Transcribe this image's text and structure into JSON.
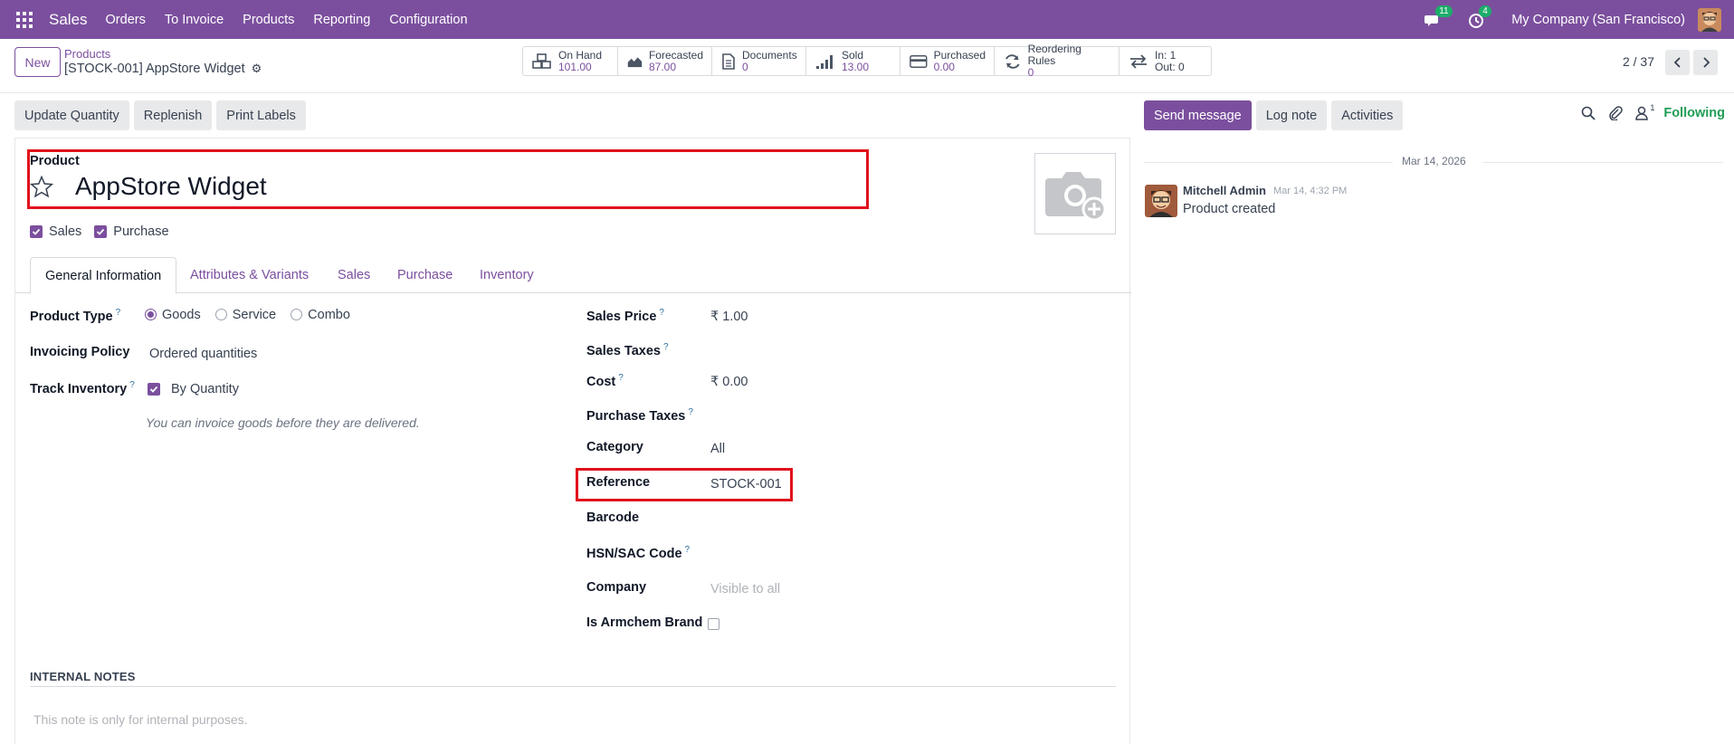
{
  "navbar": {
    "app_name": "Sales",
    "menu": [
      "Orders",
      "To Invoice",
      "Products",
      "Reporting",
      "Configuration"
    ],
    "messages_badge": "11",
    "activities_badge": "4",
    "company": "My Company (San Francisco)",
    "bar_color": "#7b4f9e"
  },
  "control": {
    "new_label": "New",
    "breadcrumb_parent": "Products",
    "breadcrumb_current": "[STOCK-001] AppStore Widget",
    "pager": "2 / 37",
    "stats": [
      {
        "label": "On Hand",
        "value": "101.00",
        "icon": "cubes-icon"
      },
      {
        "label": "Forecasted",
        "value": "87.00",
        "icon": "area-chart-icon"
      },
      {
        "label": "Documents",
        "value": "0",
        "icon": "document-icon"
      },
      {
        "label": "Sold",
        "value": "13.00",
        "icon": "signal-icon"
      },
      {
        "label": "Purchased",
        "value": "0.00",
        "icon": "credit-card-icon"
      },
      {
        "label": "Reordering Rules",
        "value": "0",
        "icon": "refresh-icon"
      }
    ],
    "inout": {
      "in": "In: 1",
      "out": "Out: 0"
    }
  },
  "actions": [
    "Update Quantity",
    "Replenish",
    "Print Labels"
  ],
  "form": {
    "product_label": "Product",
    "product_name": "AppStore Widget",
    "sales_label": "Sales",
    "purchase_label": "Purchase",
    "tabs": [
      "General Information",
      "Attributes & Variants",
      "Sales",
      "Purchase",
      "Inventory"
    ],
    "left": {
      "product_type_label": "Product Type",
      "product_type_options": [
        "Goods",
        "Service",
        "Combo"
      ],
      "invoicing_policy_label": "Invoicing Policy",
      "invoicing_policy_value": "Ordered quantities",
      "track_inventory_label": "Track Inventory",
      "track_inventory_value": "By Quantity",
      "hint": "You can invoice goods before they are delivered."
    },
    "right": {
      "sales_price_label": "Sales Price",
      "sales_price_value": "₹ 1.00",
      "sales_taxes_label": "Sales Taxes",
      "cost_label": "Cost",
      "cost_value": "₹ 0.00",
      "purchase_taxes_label": "Purchase Taxes",
      "category_label": "Category",
      "category_value": "All",
      "reference_label": "Reference",
      "reference_value": "STOCK-001",
      "barcode_label": "Barcode",
      "hsn_label": "HSN/SAC Code",
      "company_label": "Company",
      "company_placeholder": "Visible to all",
      "armchem_label": "Is Armchem Brand"
    },
    "notes_header": "INTERNAL NOTES",
    "notes_placeholder": "This note is only for internal purposes."
  },
  "chatter": {
    "send_message": "Send message",
    "log_note": "Log note",
    "activities": "Activities",
    "followers_count": "1",
    "following": "Following",
    "date": "Mar 14, 2026",
    "author": "Mitchell Admin",
    "time": "Mar 14, 4:32 PM",
    "body": "Product created"
  }
}
